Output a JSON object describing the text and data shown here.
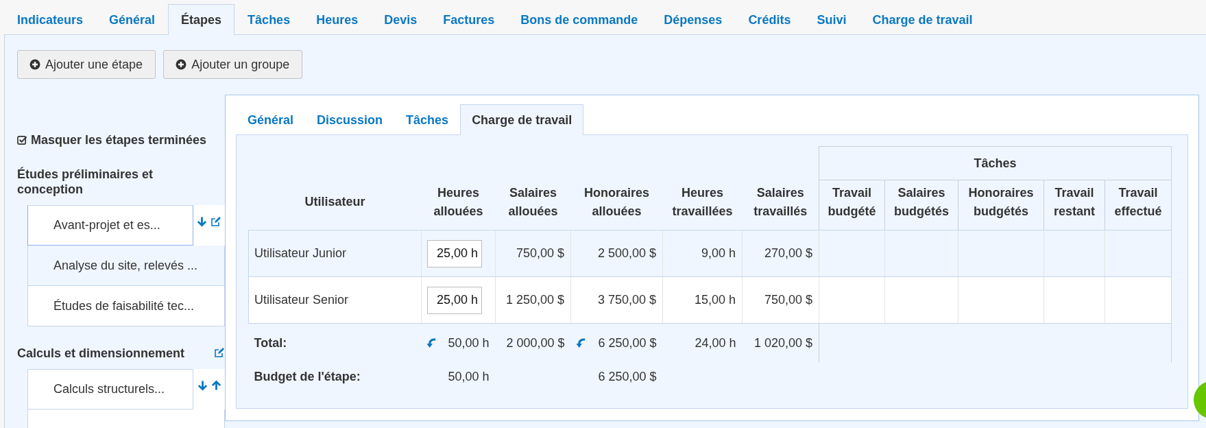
{
  "top_tabs": [
    {
      "label": "Indicateurs",
      "selected": false
    },
    {
      "label": "Général",
      "selected": false
    },
    {
      "label": "Étapes",
      "selected": true
    },
    {
      "label": "Tâches",
      "selected": false
    },
    {
      "label": "Heures",
      "selected": false
    },
    {
      "label": "Devis",
      "selected": false
    },
    {
      "label": "Factures",
      "selected": false
    },
    {
      "label": "Bons de commande",
      "selected": false
    },
    {
      "label": "Dépenses",
      "selected": false
    },
    {
      "label": "Crédits",
      "selected": false
    },
    {
      "label": "Suivi",
      "selected": false
    },
    {
      "label": "Charge de travail",
      "selected": false
    }
  ],
  "toolbar_buttons": [
    "Ajouter une étape",
    "Ajouter un groupe"
  ],
  "hide_completed": {
    "label": "Masquer les étapes terminées",
    "checked": true
  },
  "phase_groups": [
    {
      "title": "Études préliminaires et conception",
      "editable": false,
      "items": [
        {
          "label": "Avant-projet et es...",
          "selected": true,
          "hovered": false,
          "move_down": true,
          "move_up": false,
          "editable": true
        },
        {
          "label": "Analyse du site, relevés ...",
          "selected": false,
          "hovered": true,
          "move_down": false,
          "move_up": false,
          "editable": false
        },
        {
          "label": "Études de faisabilité tec...",
          "selected": false,
          "hovered": false,
          "move_down": false,
          "move_up": false,
          "editable": false
        }
      ]
    },
    {
      "title": "Calculs et dimensionnement",
      "editable": true,
      "items": [
        {
          "label": "Calculs structurels...",
          "selected": false,
          "hovered": false,
          "move_down": true,
          "move_up": true,
          "editable": false
        },
        {
          "selected": false,
          "hovered": false,
          "move_down": false,
          "move_up": false,
          "editable": false
        }
      ]
    }
  ],
  "phase_tabs": [
    {
      "label": "Général",
      "selected": false
    },
    {
      "label": "Discussion",
      "selected": false
    },
    {
      "label": "Tâches",
      "selected": false
    },
    {
      "label": "Charge de travail",
      "selected": true
    }
  ],
  "workload_table": {
    "group_header": "Tâches",
    "columns": [
      "Utilisateur",
      "Heures allouées",
      "Salaires allouées",
      "Honoraires allouées",
      "Heures travaillées",
      "Salaires travaillés",
      "Travail budgété",
      "Salaires budgétés",
      "Honoraires budgétés",
      "Travail restant",
      "Travail effectué"
    ],
    "rows": [
      {
        "user": "Utilisateur Junior",
        "allocated_hours": "25,00 h",
        "allocated_salaries": "750,00 $",
        "allocated_fees": "2 500,00 $",
        "worked_hours": "9,00 h",
        "worked_salaries": "270,00 $"
      },
      {
        "user": "Utilisateur Senior",
        "allocated_hours": "25,00 h",
        "allocated_salaries": "1 250,00 $",
        "allocated_fees": "3 750,00 $",
        "worked_hours": "15,00 h",
        "worked_salaries": "750,00 $"
      }
    ],
    "total": {
      "label": "Total:",
      "cells": [
        {
          "value": "50,00 h",
          "revert": true
        },
        {
          "value": "2 000,00 $",
          "revert": false
        },
        {
          "value": "6 250,00 $",
          "revert": true
        },
        {
          "value": "24,00 h",
          "revert": false
        },
        {
          "value": "1 020,00 $",
          "revert": false
        }
      ]
    },
    "budget": {
      "label": "Budget de l'étape:",
      "cells": [
        {
          "value": "50,00 h"
        },
        {},
        {
          "value": "6 250,00 $"
        },
        {},
        {}
      ]
    }
  }
}
